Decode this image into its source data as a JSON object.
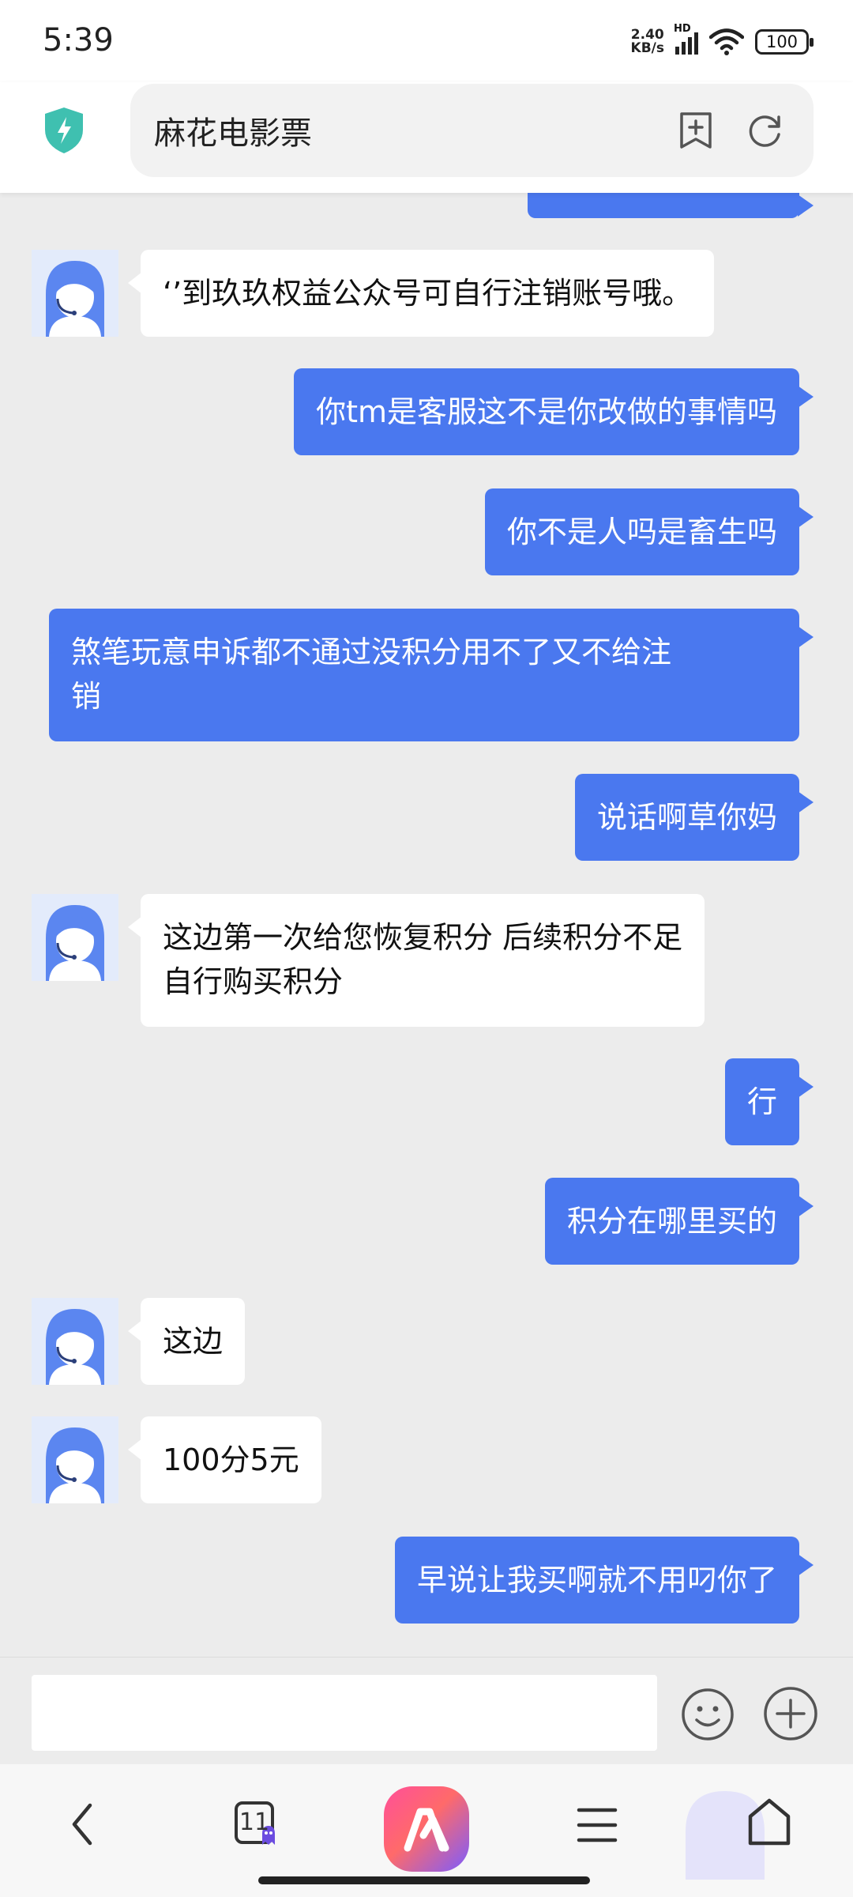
{
  "status_bar": {
    "time": "5:39",
    "net_speed_value": "2.40",
    "net_speed_unit": "KB/s",
    "network_label": "HD",
    "battery": "100",
    "icons": [
      "signal-icon",
      "wifi-icon",
      "battery-icon"
    ]
  },
  "address_bar": {
    "title": "麻花电影票",
    "icons": [
      "shield-icon",
      "add-bookmark-icon",
      "refresh-icon"
    ],
    "shield_color": "#3fc0b0"
  },
  "chat": {
    "messages": [
      {
        "side": "in",
        "lines": [
          "‘’到玖玖权益公众号可自行注销账号哦。"
        ]
      },
      {
        "side": "out",
        "lines": [
          "你tm是客服这不是你改做的事情吗"
        ]
      },
      {
        "side": "out",
        "lines": [
          "你不是人吗是畜生吗"
        ]
      },
      {
        "side": "out",
        "lines": [
          "煞笔玩意申诉都不通过没积分用不了又不给注",
          "销"
        ]
      },
      {
        "side": "out",
        "lines": [
          "说话啊草你妈"
        ]
      },
      {
        "side": "in",
        "lines": [
          "这边第一次给您恢复积分 后续积分不足",
          "自行购买积分"
        ]
      },
      {
        "side": "out",
        "lines": [
          "行"
        ]
      },
      {
        "side": "out",
        "lines": [
          "积分在哪里买的"
        ]
      },
      {
        "side": "in",
        "lines": [
          "这边"
        ]
      },
      {
        "side": "in",
        "lines": [
          "100分5元"
        ]
      },
      {
        "side": "out",
        "lines": [
          "早说让我买啊就不用叼你了"
        ]
      }
    ]
  },
  "input_area": {
    "placeholder": "",
    "icons": [
      "emoji-icon",
      "plus-icon"
    ]
  },
  "bottom_nav": {
    "tab_count": "11",
    "icons": [
      "back-icon",
      "tabs-icon",
      "app-logo-icon",
      "menu-icon",
      "home-icon"
    ]
  },
  "colors": {
    "outgoing_bubble": "#4a78ef",
    "incoming_bubble": "#ffffff",
    "chat_background": "#ececec",
    "avatar_accent": "#5b86f0"
  }
}
